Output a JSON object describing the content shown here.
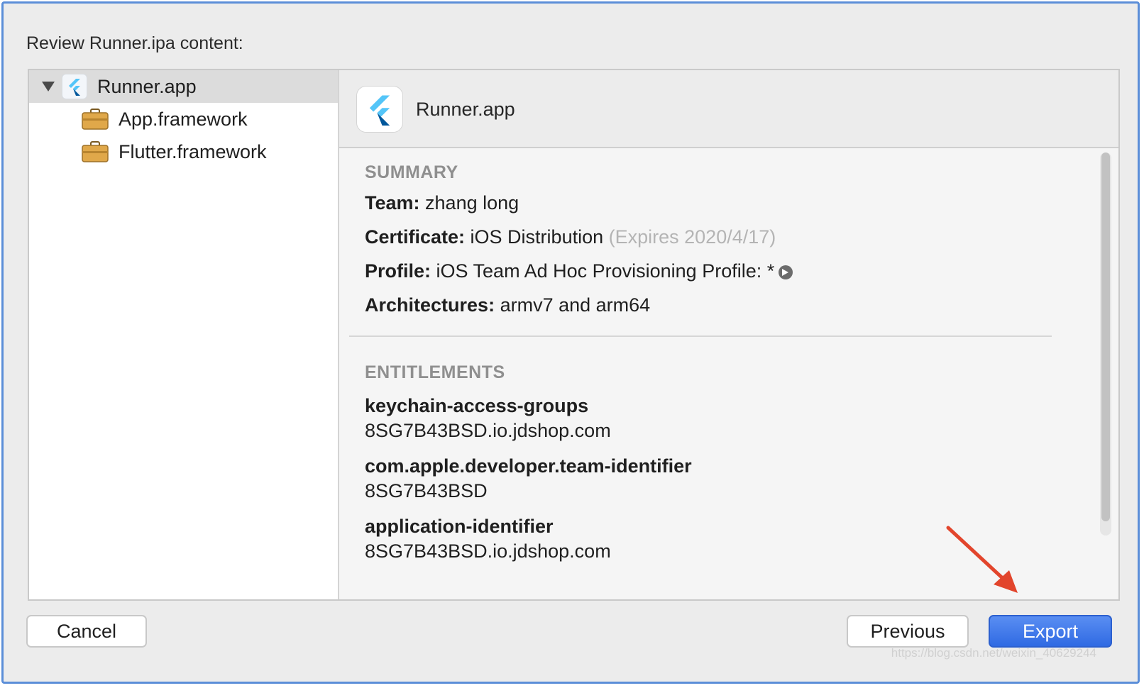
{
  "dialog": {
    "title": "Review Runner.ipa content:"
  },
  "sidebar": {
    "items": [
      {
        "label": "Runner.app",
        "icon": "flutter-icon",
        "selected": true
      },
      {
        "label": "App.framework",
        "icon": "briefcase-icon"
      },
      {
        "label": "Flutter.framework",
        "icon": "briefcase-icon"
      }
    ]
  },
  "detail": {
    "header_title": "Runner.app",
    "summary": {
      "heading": "SUMMARY",
      "team_label": "Team:",
      "team_value": " zhang long",
      "certificate_label": "Certificate:",
      "certificate_value": " iOS Distribution ",
      "certificate_note": "(Expires 2020/4/17)",
      "profile_label": "Profile:",
      "profile_value": " iOS Team Ad Hoc Provisioning Profile: *",
      "architectures_label": "Architectures:",
      "architectures_value": " armv7 and arm64"
    },
    "entitlements": {
      "heading": "ENTITLEMENTS",
      "items": [
        {
          "key": "keychain-access-groups",
          "value": "8SG7B43BSD.io.jdshop.com"
        },
        {
          "key": "com.apple.developer.team-identifier",
          "value": "8SG7B43BSD"
        },
        {
          "key": "application-identifier",
          "value": "8SG7B43BSD.io.jdshop.com"
        }
      ]
    }
  },
  "buttons": {
    "cancel": "Cancel",
    "previous": "Previous",
    "export": "Export"
  },
  "watermark": "https://blog.csdn.net/weixin_40629244",
  "colors": {
    "accent": "#2f6ae3",
    "annotation": "#e2452c",
    "frame": "#5b8ed8"
  }
}
